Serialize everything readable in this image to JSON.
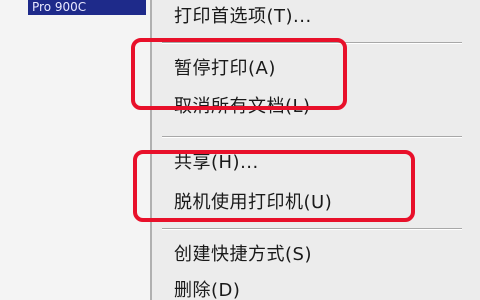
{
  "window": {
    "selected_item_text": "Pro 900C"
  },
  "context_menu": {
    "items": [
      {
        "name": "menu-item-printing-preferences",
        "label": "打印首选项(T)..."
      },
      {
        "name": "menu-item-pause-printing",
        "label": "暂停打印(A)"
      },
      {
        "name": "menu-item-cancel-all-documents",
        "label": "取消所有文档(L)"
      },
      {
        "name": "menu-item-sharing",
        "label": "共享(H)..."
      },
      {
        "name": "menu-item-use-printer-offline",
        "label": "脱机使用打印机(U)"
      },
      {
        "name": "menu-item-create-shortcut",
        "label": "创建快捷方式(S)"
      },
      {
        "name": "menu-item-delete",
        "label": "删除(D)"
      }
    ]
  },
  "annotations": {
    "highlight_color": "#e8102a"
  }
}
